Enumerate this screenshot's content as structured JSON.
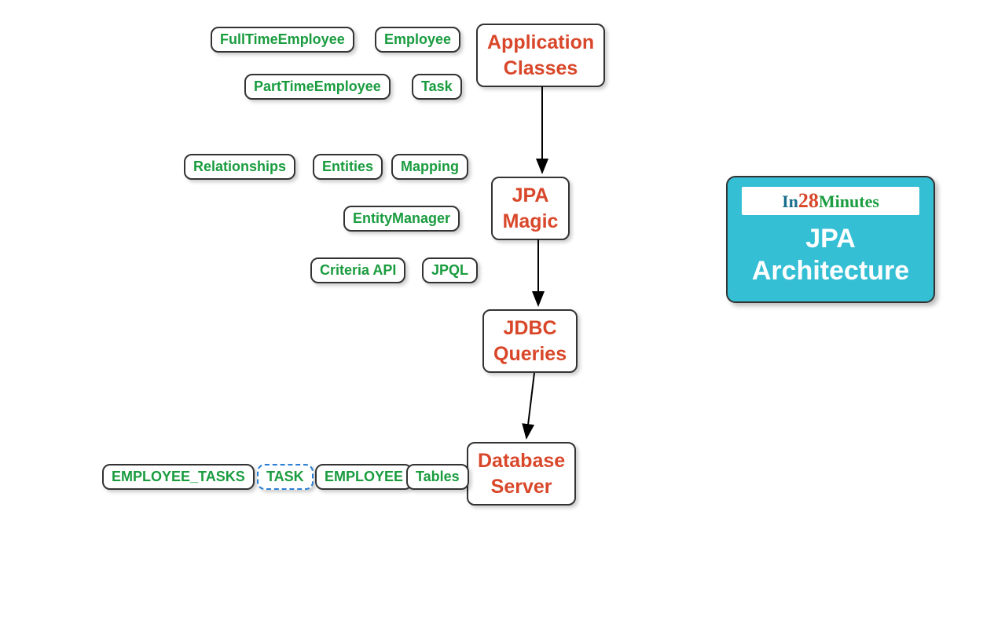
{
  "nodes": {
    "appClasses": "Application\nClasses",
    "fullTimeEmployee": "FullTimeEmployee",
    "employee": "Employee",
    "partTimeEmployee": "PartTimeEmployee",
    "task": "Task",
    "jpaMagic": "JPA\nMagic",
    "relationships": "Relationships",
    "entities": "Entities",
    "mapping": "Mapping",
    "entityManager": "EntityManager",
    "criteriaApi": "Criteria API",
    "jpql": "JPQL",
    "jdbcQueries": "JDBC\nQueries",
    "databaseServer": "Database\nServer",
    "employeeTasks": "EMPLOYEE_TASKS",
    "taskTable": "TASK",
    "employeeTable": "EMPLOYEE",
    "tables": "Tables"
  },
  "titleCard": {
    "logo": {
      "in": "In",
      "num": "28",
      "min": "Minutes"
    },
    "title": "JPA\nArchitecture"
  },
  "diagram": {
    "type": "mindmap-flowchart",
    "description": "JPA Architecture layered diagram",
    "flow": [
      "Application Classes",
      "JPA Magic",
      "JDBC Queries",
      "Database Server"
    ],
    "children": {
      "Application Classes": [
        "FullTimeEmployee",
        "Employee",
        "PartTimeEmployee",
        "Task"
      ],
      "JPA Magic": [
        "Relationships",
        "Entities",
        "Mapping",
        "EntityManager",
        "Criteria API",
        "JPQL"
      ],
      "Database Server": [
        "EMPLOYEE_TASKS",
        "TASK",
        "EMPLOYEE",
        "Tables"
      ]
    },
    "selected": "TASK"
  }
}
